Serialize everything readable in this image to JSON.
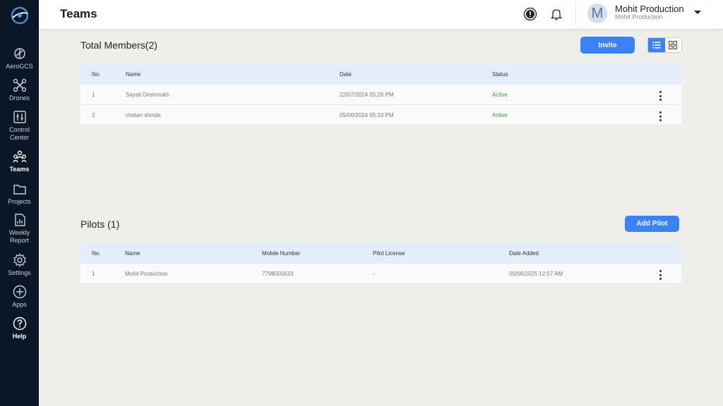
{
  "sidebar": {
    "items": [
      {
        "label": "AeroGCS",
        "icon": "aerogcs-icon"
      },
      {
        "label": "Drones",
        "icon": "drone-icon"
      },
      {
        "label": "Control\nCenter",
        "icon": "control-center-icon"
      },
      {
        "label": "Teams",
        "icon": "teams-icon",
        "active": true
      },
      {
        "label": "Projects",
        "icon": "folder-icon"
      },
      {
        "label": "Weekly\nReport",
        "icon": "report-icon"
      },
      {
        "label": "Settings",
        "icon": "gear-icon"
      },
      {
        "label": "Apps",
        "icon": "plus-circle-icon"
      },
      {
        "label": "Help",
        "icon": "help-icon"
      }
    ]
  },
  "header": {
    "title": "Teams",
    "user_name": "Mohit Production",
    "user_org": "Mohit Production",
    "avatar_initial": "M"
  },
  "members": {
    "title": "Total Members(2)",
    "invite_label": "Invite",
    "columns": [
      "No.",
      "Name",
      "Date",
      "Status"
    ],
    "rows": [
      {
        "no": "1",
        "name": "Sayali Deshmukh",
        "date": "22/07/2024 05:28 PM",
        "status": "Active"
      },
      {
        "no": "2",
        "name": "chetan shinde",
        "date": "05/06/2024 05:33 PM",
        "status": "Active"
      }
    ]
  },
  "pilots": {
    "title": "Pilots (1)",
    "add_label": "Add Pilot",
    "columns": [
      "No.",
      "Name",
      "Mobile Number",
      "Pilot License",
      "Date Added"
    ],
    "rows": [
      {
        "no": "1",
        "name": "Mohit Production",
        "mobile": "7798005633",
        "license": "-",
        "date_added": "05/06/2025 12:57 AM"
      }
    ]
  },
  "colors": {
    "sidebar_bg": "#0b1626",
    "accent": "#3b82f6",
    "status_active": "#2e9e44",
    "table_header_bg": "#e3edfb"
  }
}
